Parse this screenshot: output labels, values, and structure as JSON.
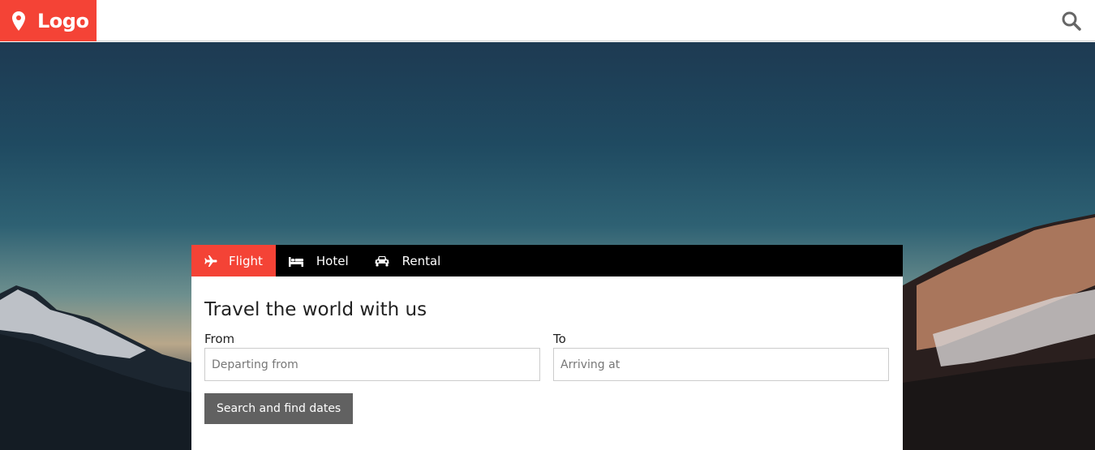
{
  "header": {
    "logo_text": "Logo",
    "logo_icon": "map-marker-icon",
    "search_icon": "search-icon"
  },
  "booking": {
    "tabs": [
      {
        "label": "Flight",
        "icon": "plane-icon",
        "active": true
      },
      {
        "label": "Hotel",
        "icon": "bed-icon",
        "active": false
      },
      {
        "label": "Rental",
        "icon": "car-icon",
        "active": false
      }
    ],
    "heading": "Travel the world with us",
    "from": {
      "label": "From",
      "placeholder": "Departing from"
    },
    "to": {
      "label": "To",
      "placeholder": "Arriving at"
    },
    "submit_label": "Search and find dates"
  },
  "colors": {
    "accent": "#f44336",
    "tabbar": "#000000",
    "button": "#616161"
  }
}
